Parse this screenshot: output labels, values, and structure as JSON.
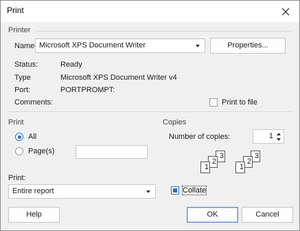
{
  "window": {
    "title": "Print"
  },
  "printer": {
    "group_label": "Printer",
    "name_label": "Name",
    "selected_printer": "Microsoft XPS Document Writer",
    "properties_label": "Properties...",
    "status_label": "Status:",
    "status_value": "Ready",
    "type_label": "Type",
    "type_value": "Microsoft XPS Document Writer v4",
    "port_label": "Port:",
    "port_value": "PORTPROMPT:",
    "comments_label": "Comments:",
    "print_to_file_label": "Print to file",
    "print_to_file_checked": false
  },
  "print_range": {
    "group_label": "Print",
    "all_label": "All",
    "all_selected": true,
    "pages_label": "Page(s)",
    "pages_value": ""
  },
  "copies": {
    "group_label": "Copies",
    "number_label": "Number of copies:",
    "number_value": "1",
    "collate_label": "Collate",
    "collate_checked": true,
    "collate_illustration_digits": [
      "1",
      "2",
      "3"
    ]
  },
  "print_what": {
    "label": "Print:",
    "selected": "Entire report"
  },
  "buttons": {
    "help": "Help",
    "ok": "OK",
    "cancel": "Cancel"
  },
  "colors": {
    "accent": "#2470c9",
    "dialog_bg": "#f0f0f0",
    "titlebar_bg": "#ffffff"
  }
}
